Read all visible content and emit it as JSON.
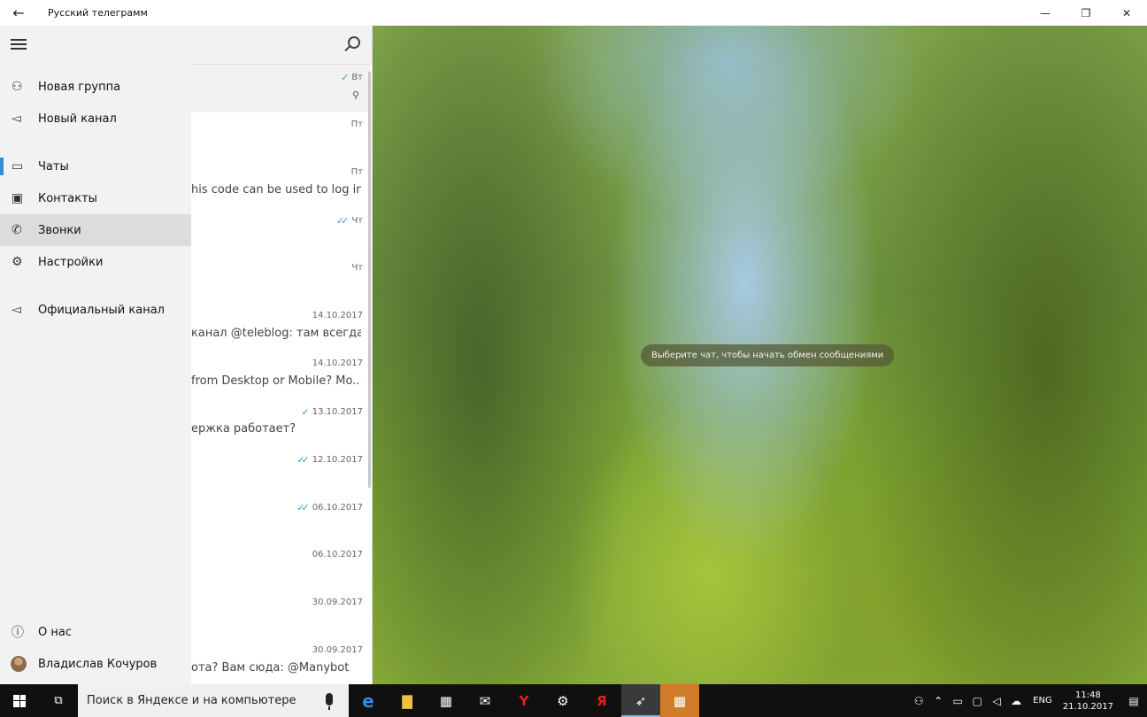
{
  "titlebar": {
    "title": "Русский телеграмм",
    "back_icon": "←",
    "minimize_icon": "—",
    "maximize_icon": "❐",
    "close_icon": "✕"
  },
  "chat_list": {
    "items": [
      {
        "date": "Вт",
        "checks": "✓",
        "preview": "",
        "pinned": true
      },
      {
        "date": "Пт",
        "checks": "",
        "preview": ""
      },
      {
        "date": "Пт",
        "checks": "",
        "preview": "his code can be used to log in..."
      },
      {
        "date": "Чт",
        "checks": "✓✓",
        "preview": ""
      },
      {
        "date": "Чт",
        "checks": "",
        "preview": ""
      },
      {
        "date": "14.10.2017",
        "checks": "",
        "preview": "канал @teleblog: там всегда..."
      },
      {
        "date": "14.10.2017",
        "checks": "",
        "preview": "from Desktop or Mobile?  Mo..."
      },
      {
        "date": "13.10.2017",
        "checks": "✓",
        "preview": "ержка работает?"
      },
      {
        "date": "12.10.2017",
        "checks": "✓✓",
        "preview": ""
      },
      {
        "date": "06.10.2017",
        "checks": "✓✓",
        "preview": ""
      },
      {
        "date": "06.10.2017",
        "checks": "",
        "preview": ""
      },
      {
        "date": "30.09.2017",
        "checks": "",
        "preview": ""
      },
      {
        "date": "30.09.2017",
        "checks": "",
        "preview": "ота? Вам сюда: @Manybot"
      }
    ]
  },
  "main": {
    "hint": "Выберите чат, чтобы начать обмен сообщениями"
  },
  "menu": {
    "new_group": "Новая группа",
    "new_channel": "Новый канал",
    "chats": "Чаты",
    "contacts": "Контакты",
    "calls": "Звонки",
    "settings": "Настройки",
    "official_channel": "Официальный канал",
    "about": "О нас",
    "user_name": "Владислав Кочуров"
  },
  "taskbar": {
    "search_placeholder": "Поиск в Яндексе и на компьютере",
    "lang": "ENG",
    "time": "11:48",
    "date": "21.10.2017"
  }
}
